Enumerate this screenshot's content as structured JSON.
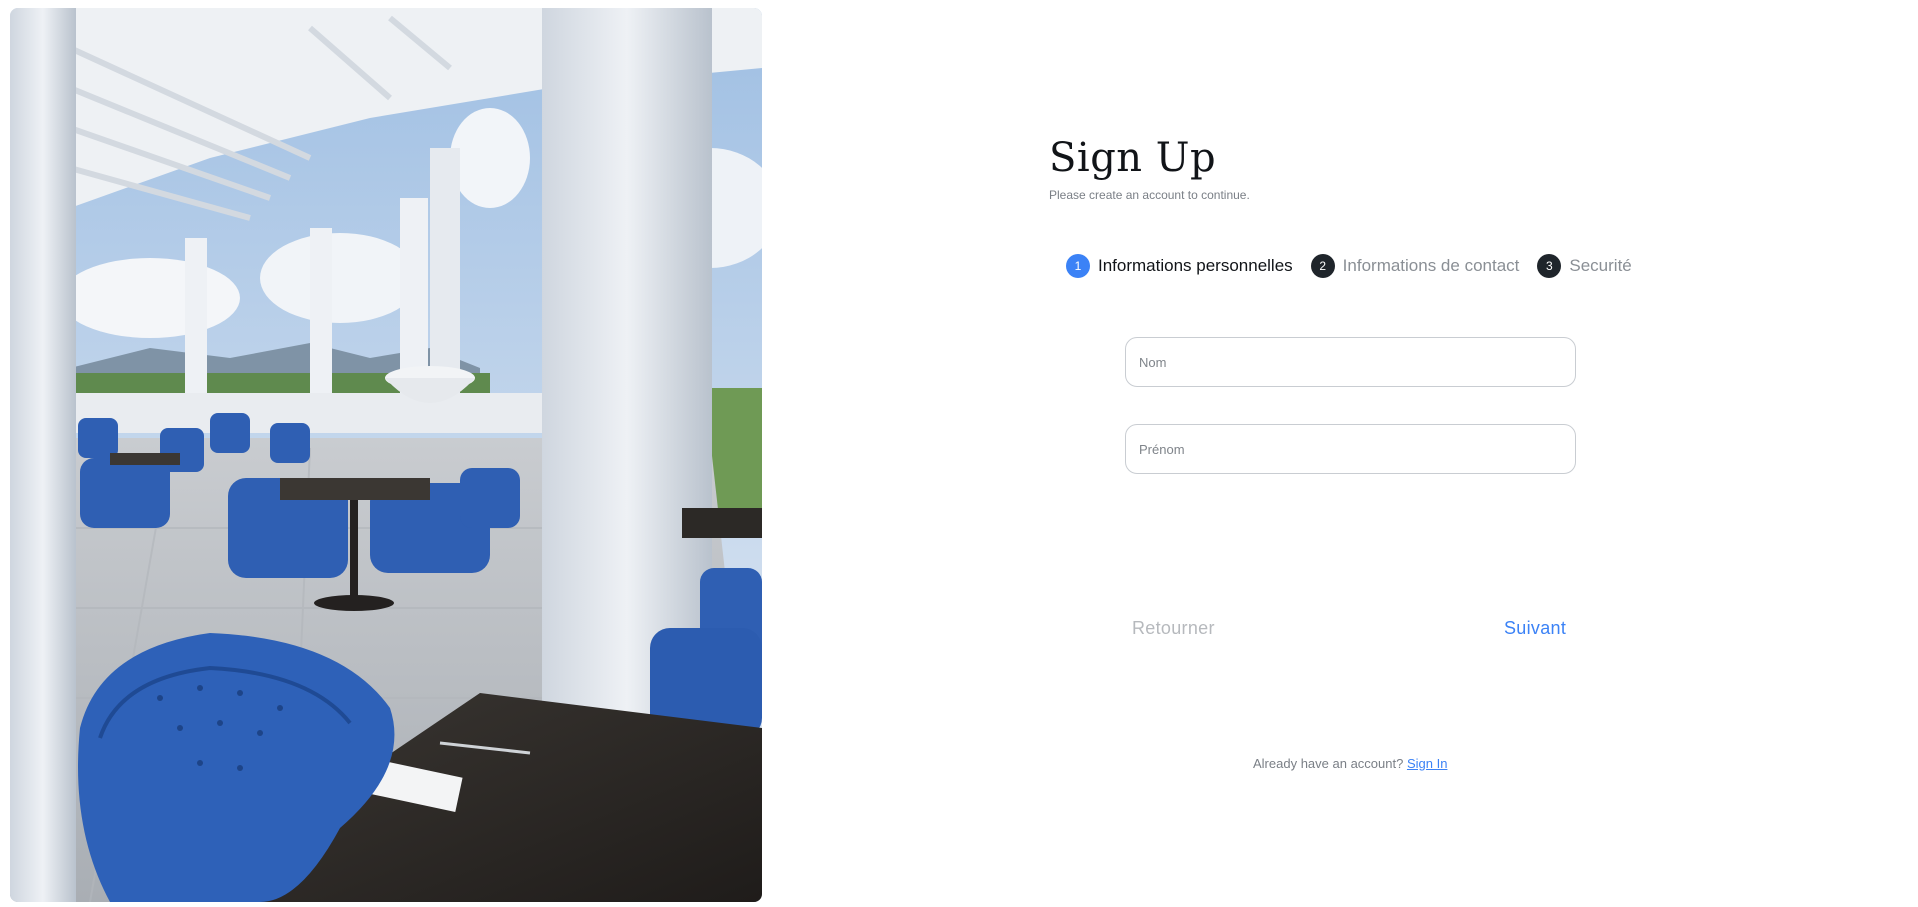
{
  "hero": {
    "icon": "restaurant-terrace-photo"
  },
  "header": {
    "title": "Sign Up",
    "subtitle": "Please create an account to continue."
  },
  "stepper": {
    "active_step": 1,
    "steps": [
      {
        "number": "1",
        "label": "Informations personnelles"
      },
      {
        "number": "2",
        "label": "Informations de contact"
      },
      {
        "number": "3",
        "label": "Securité"
      }
    ]
  },
  "form": {
    "nom": {
      "placeholder": "Nom",
      "value": ""
    },
    "prenom": {
      "placeholder": "Prénom",
      "value": ""
    }
  },
  "actions": {
    "back_label": "Retourner",
    "next_label": "Suivant"
  },
  "footer": {
    "prompt": "Already have an account?",
    "link_label": "Sign In"
  },
  "colors": {
    "accent": "#3b82f6",
    "step_inactive": "#1f252b",
    "text_muted": "#7a7f86"
  }
}
